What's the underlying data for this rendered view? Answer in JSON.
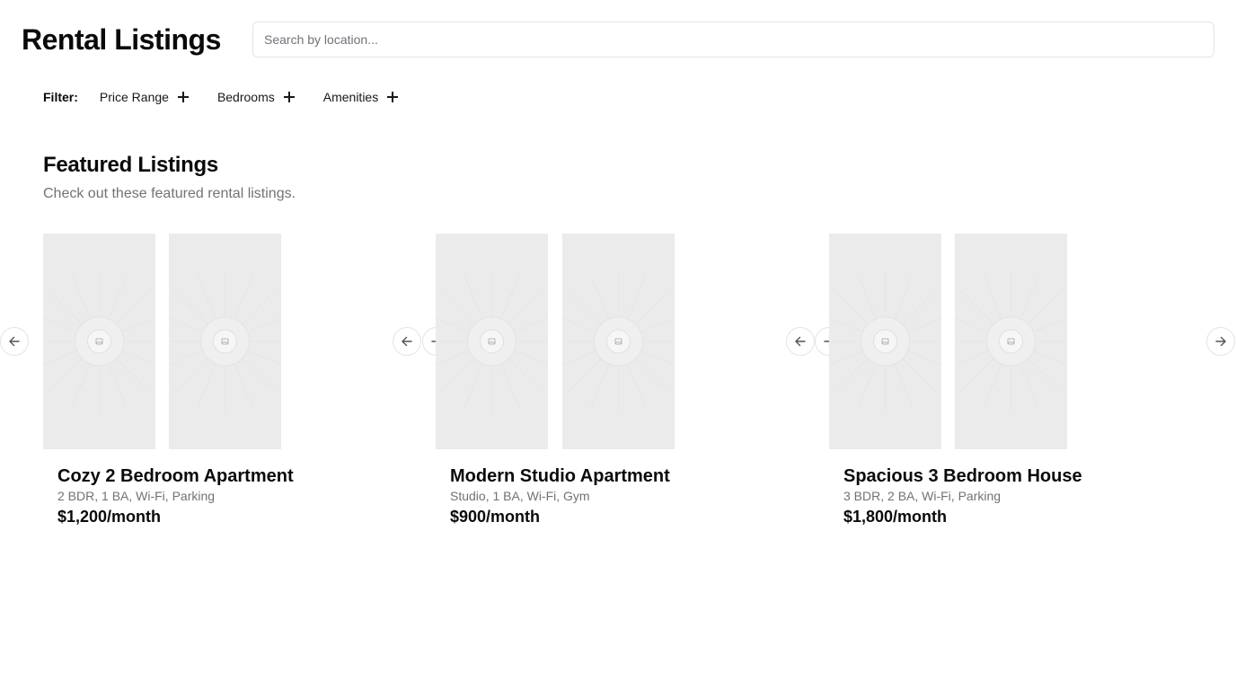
{
  "header": {
    "title": "Rental Listings",
    "search_placeholder": "Search by location..."
  },
  "filters": {
    "label": "Filter:",
    "items": [
      {
        "label": "Price Range",
        "icon": "plus-icon"
      },
      {
        "label": "Bedrooms",
        "icon": "plus-icon"
      },
      {
        "label": "Amenities",
        "icon": "plus-icon"
      }
    ]
  },
  "featured": {
    "title": "Featured Listings",
    "description": "Check out these featured rental listings."
  },
  "listings": [
    {
      "title": "Cozy 2 Bedroom Apartment",
      "features": "2 BDR, 1 BA, Wi-Fi, Parking",
      "price": "$1,200/month"
    },
    {
      "title": "Modern Studio Apartment",
      "features": "Studio, 1 BA, Wi-Fi, Gym",
      "price": "$900/month"
    },
    {
      "title": "Spacious 3 Bedroom House",
      "features": "3 BDR, 2 BA, Wi-Fi, Parking",
      "price": "$1,800/month"
    }
  ],
  "icons": {
    "carousel_prev": "arrow-left-icon",
    "carousel_next": "arrow-right-icon",
    "image_placeholder": "image-placeholder-icon"
  },
  "colors": {
    "text": "#0a0a0a",
    "muted": "#71717a",
    "border": "#e4e4e7",
    "placeholder_bg": "#ebebeb"
  }
}
